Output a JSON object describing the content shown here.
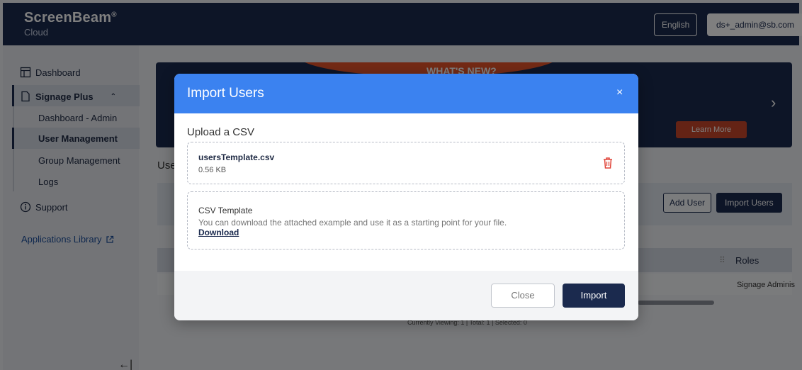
{
  "header": {
    "brand": "ScreenBeam",
    "brand_mark": "®",
    "brand_sub": "Cloud",
    "language": "English",
    "user": "ds+_admin@sb.com"
  },
  "sidebar": {
    "items": [
      {
        "label": "Dashboard"
      },
      {
        "label": "Signage Plus"
      },
      {
        "label": "Support"
      }
    ],
    "sub_items": [
      "Dashboard - Admin",
      "User Management",
      "Group Management",
      "Logs"
    ],
    "app_library": "Applications Library"
  },
  "background": {
    "banner_title": "WHAT'S NEW?",
    "learn_more": "Learn More",
    "section_label": "Use",
    "add_user": "Add User",
    "import_users": "Import Users",
    "roles_header": "Roles",
    "roles_value": "Signage Adminis",
    "viewing_text": "Currently Viewing: 1  |  Total: 1  |  Selected: 0"
  },
  "modal": {
    "title": "Import Users",
    "close_symbol": "×",
    "upload_title": "Upload a CSV",
    "file_name": "usersTemplate.csv",
    "file_size": "0.56 KB",
    "template_title": "CSV Template",
    "template_desc": "You can download the attached example and use it as a starting point for your file.",
    "download_link": "Download",
    "close_button": "Close",
    "import_button": "Import"
  },
  "colors": {
    "navy": "#1b2a4e",
    "modal_header": "#3b82f0",
    "delete": "#e0453a"
  }
}
